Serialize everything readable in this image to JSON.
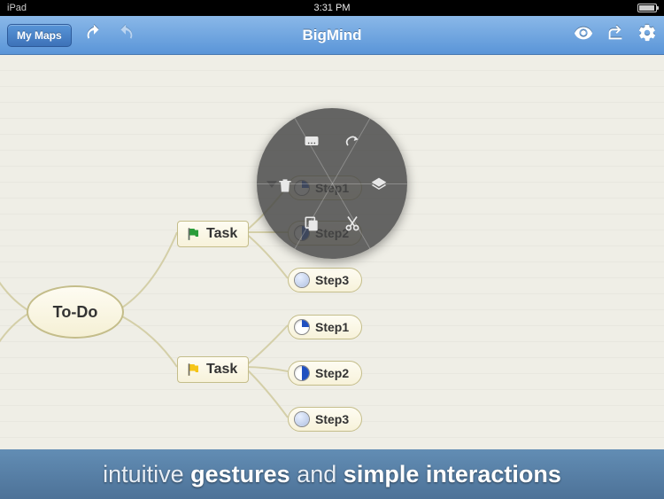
{
  "statusBar": {
    "device": "iPad",
    "time": "3:31 PM"
  },
  "toolbar": {
    "myMaps": "My Maps",
    "title": "BigMind"
  },
  "mindmap": {
    "root": "To-Do",
    "task1": {
      "label": "Task",
      "flagColor": "green",
      "steps": {
        "s1": "Step1",
        "s2": "Step2",
        "s3": "Step3"
      }
    },
    "task2": {
      "label": "Task",
      "flagColor": "yellow",
      "steps": {
        "s1": "Step1",
        "s2": "Step2",
        "s3": "Step3"
      }
    }
  },
  "radialMenu": {
    "items": [
      "note",
      "relationship",
      "delete",
      "layers",
      "copy",
      "cut"
    ]
  },
  "caption": {
    "w1": "intuitive",
    "w2": "gestures",
    "w3": "and",
    "w4": "simple",
    "w5": "interactions"
  }
}
